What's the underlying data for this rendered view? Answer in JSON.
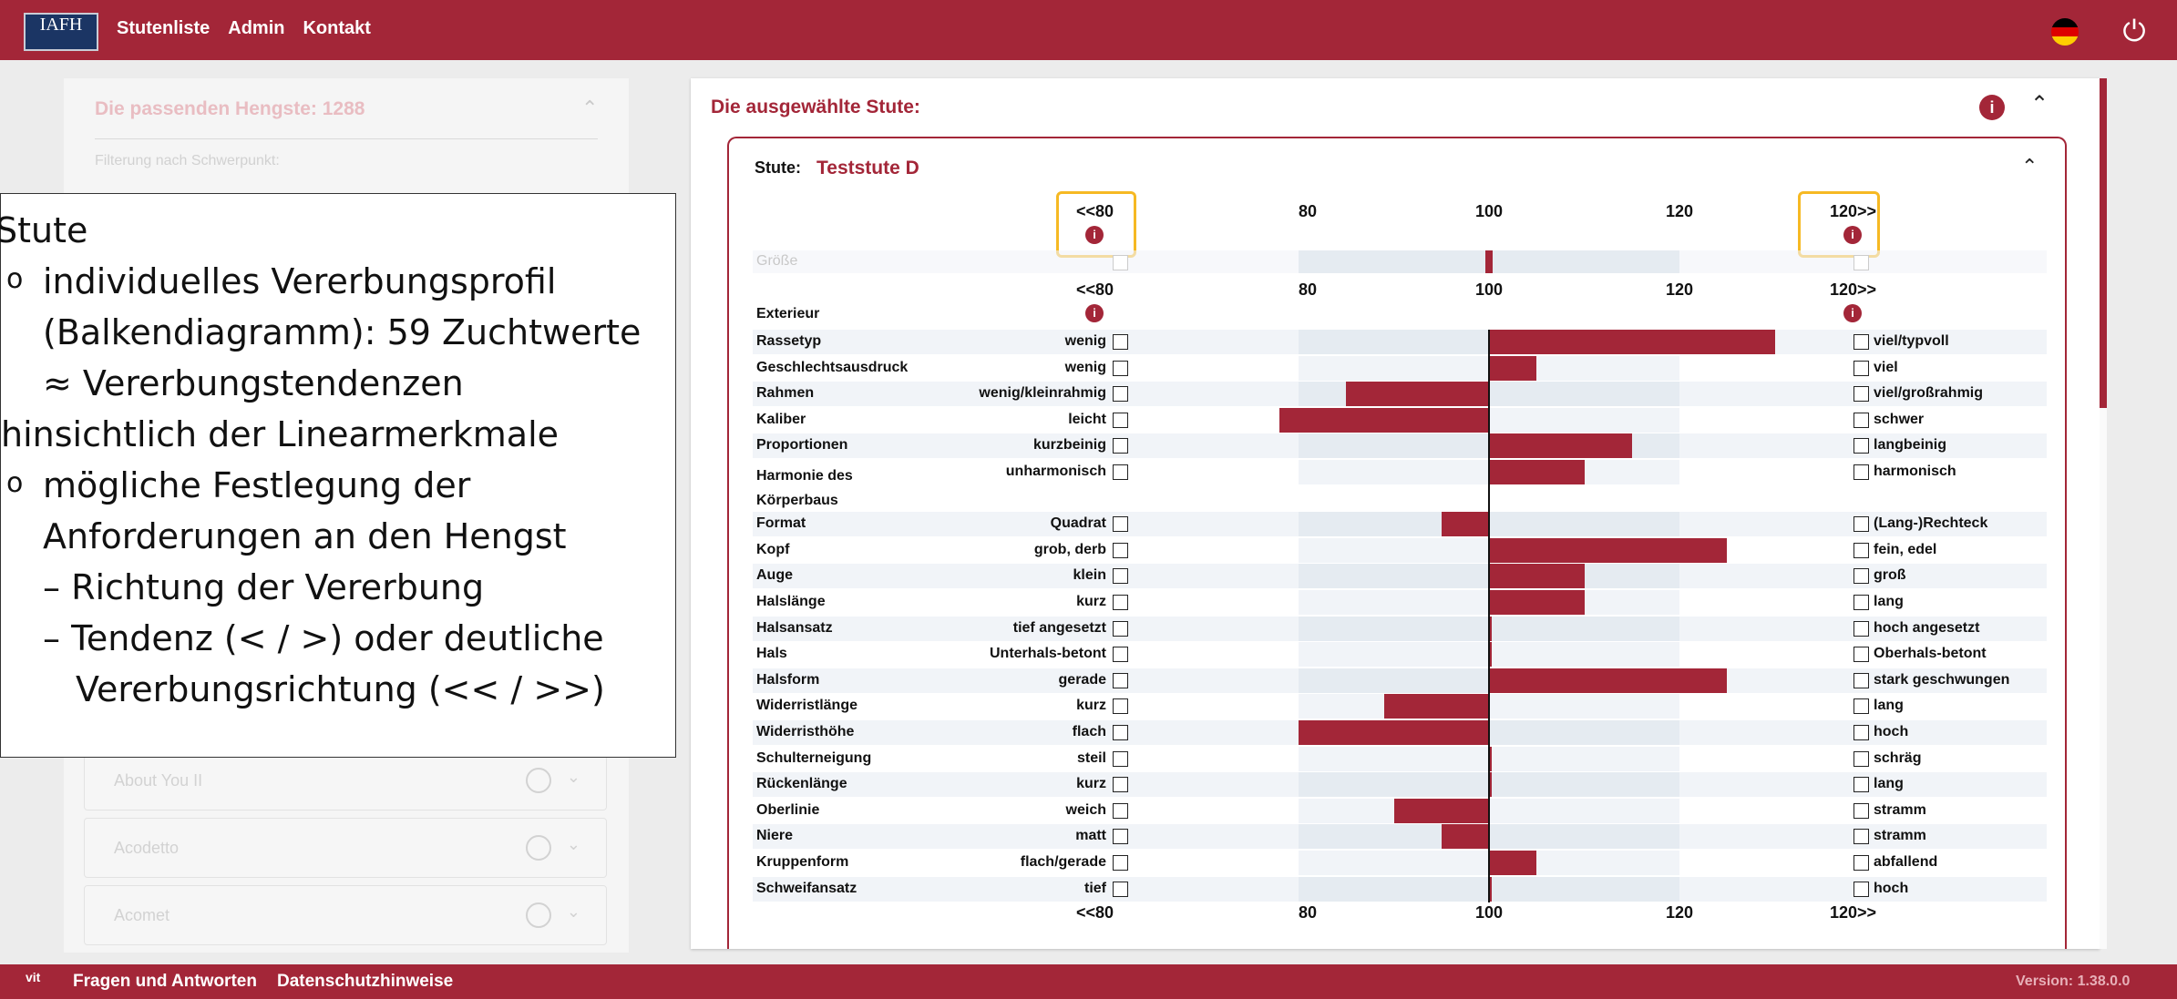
{
  "topbar": {
    "logo_text": "IAFH",
    "nav": [
      "Stutenliste",
      "Admin",
      "Kontakt"
    ],
    "flag_colors": [
      "#000000",
      "#dd0000",
      "#ffce00"
    ],
    "power_icon": "⏻"
  },
  "left_panel": {
    "title": "Die passenden Hengste: 1288",
    "filter_label": "Filterung nach Schwerpunkt:",
    "items": [
      "About You II",
      "Acodetto",
      "Acomet"
    ]
  },
  "main": {
    "title": "Die ausgewählte Stute:",
    "stute_label": "Stute:",
    "stute_name": "Teststute D",
    "info_icon": "i",
    "scale": [
      "<<80",
      "80",
      "100",
      "120",
      "120>>"
    ],
    "groesse_label": "Größe",
    "section_label": "Exterieur"
  },
  "chart_data": {
    "type": "bar",
    "title": "",
    "xlabel": "",
    "ylabel": "",
    "xlim": [
      70,
      130
    ],
    "baseline": 100,
    "groesse_value": 100,
    "rows": [
      {
        "label": "Rassetyp",
        "low": "wenig",
        "high": "viel/typvoll",
        "value": 130
      },
      {
        "label": "Geschlechtsausdruck",
        "low": "wenig",
        "high": "viel",
        "value": 105
      },
      {
        "label": "Rahmen",
        "low": "wenig/kleinrahmig",
        "high": "viel/großrahmig",
        "value": 85
      },
      {
        "label": "Kaliber",
        "low": "leicht",
        "high": "schwer",
        "value": 78
      },
      {
        "label": "Proportionen",
        "low": "kurzbeinig",
        "high": "langbeinig",
        "value": 115
      },
      {
        "label": "Harmonie des Körperbaus",
        "low": "unharmonisch",
        "high": "harmonisch",
        "value": 110
      },
      {
        "label": "Format",
        "low": "Quadrat",
        "high": "(Lang-)Rechteck",
        "value": 95
      },
      {
        "label": "Kopf",
        "low": "grob, derb",
        "high": "fein, edel",
        "value": 125
      },
      {
        "label": "Auge",
        "low": "klein",
        "high": "groß",
        "value": 110
      },
      {
        "label": "Halslänge",
        "low": "kurz",
        "high": "lang",
        "value": 110
      },
      {
        "label": "Halsansatz",
        "low": "tief angesetzt",
        "high": "hoch angesetzt",
        "value": 100.3
      },
      {
        "label": "Hals",
        "low": "Unterhals-betont",
        "high": "Oberhals-betont",
        "value": 100.3
      },
      {
        "label": "Halsform",
        "low": "gerade",
        "high": "stark geschwungen",
        "value": 125
      },
      {
        "label": "Widerristlänge",
        "low": "kurz",
        "high": "lang",
        "value": 89
      },
      {
        "label": "Widerristhöhe",
        "low": "flach",
        "high": "hoch",
        "value": 80
      },
      {
        "label": "Schulterneigung",
        "low": "steil",
        "high": "schräg",
        "value": 100.3
      },
      {
        "label": "Rückenlänge",
        "low": "kurz",
        "high": "lang",
        "value": 100.3
      },
      {
        "label": "Oberlinie",
        "low": "weich",
        "high": "stramm",
        "value": 90
      },
      {
        "label": "Niere",
        "low": "matt",
        "high": "stramm",
        "value": 95
      },
      {
        "label": "Kruppenform",
        "low": "flach/gerade",
        "high": "abfallend",
        "value": 105
      },
      {
        "label": "Schweifansatz",
        "low": "tief",
        "high": "hoch",
        "value": 100.3
      }
    ]
  },
  "overlay": {
    "lines": [
      "Stute",
      "individuelles Vererbungsprofil",
      "(Balkendiagramm): 59 Zuchtwerte",
      "≈ Vererbungstendenzen",
      "hinsichtlich der Linearmerkmale",
      "mögliche Festlegung der",
      "Anforderungen an den Hengst",
      "– Richtung der Vererbung",
      "– Tendenz (< / >) oder deutliche",
      "Vererbungsrichtung (<< / >>)"
    ],
    "bullet": "o"
  },
  "footer": {
    "vit_label": "vit",
    "faq": "Fragen und Antworten",
    "privacy": "Datenschutzhinweise",
    "version": "Version: 1.38.0.0"
  },
  "colors": {
    "brand": "#a32638",
    "highlight": "#f6b923",
    "band_dark": "#e5ebf1",
    "band_light": "#f1f4f8"
  }
}
